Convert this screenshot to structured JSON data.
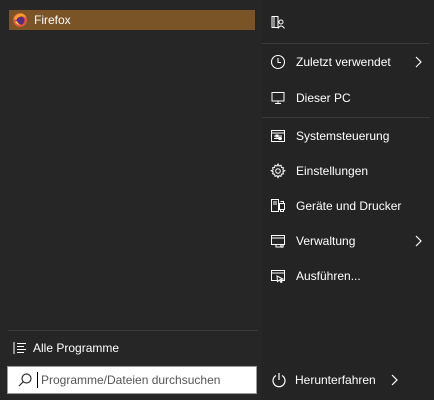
{
  "pinned": [
    {
      "label": "Firefox",
      "icon": "firefox-icon"
    }
  ],
  "left": {
    "all_programs_label": "Alle Programme",
    "search_placeholder": "Programme/Dateien durchsuchen"
  },
  "right": {
    "user_icon": "user-folder-icon",
    "items": [
      {
        "label": "Zuletzt verwendet",
        "icon": "clock-icon",
        "has_submenu": true
      },
      {
        "label": "Dieser PC",
        "icon": "computer-icon",
        "has_submenu": false
      },
      {
        "label": "Systemsteuerung",
        "icon": "control-panel-icon",
        "has_submenu": false
      },
      {
        "label": "Einstellungen",
        "icon": "gear-icon",
        "has_submenu": false
      },
      {
        "label": "Geräte und Drucker",
        "icon": "printer-icon",
        "has_submenu": false
      },
      {
        "label": "Verwaltung",
        "icon": "admin-tools-icon",
        "has_submenu": true
      },
      {
        "label": "Ausführen...",
        "icon": "run-icon",
        "has_submenu": false
      }
    ],
    "shutdown_label": "Herunterfahren"
  },
  "colors": {
    "highlight": "#7a5327",
    "background": "#252525",
    "text": "#ffffff"
  }
}
